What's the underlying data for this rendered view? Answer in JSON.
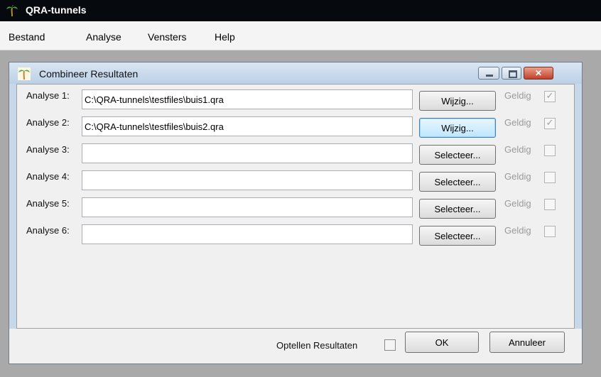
{
  "app": {
    "title": "QRA-tunnels",
    "icon": "palm-tree-icon",
    "menu": [
      "Bestand",
      "Analyse",
      "Vensters",
      "Help"
    ]
  },
  "dialog": {
    "title": "Combineer Resultaten",
    "icon": "palm-tree-icon",
    "rows": [
      {
        "label": "Analyse 1:",
        "path": "C:\\QRA-tunnels\\testfiles\\buis1.qra",
        "button": "Wijzig...",
        "valid_label": "Geldig",
        "valid_checked": true
      },
      {
        "label": "Analyse 2:",
        "path": "C:\\QRA-tunnels\\testfiles\\buis2.qra",
        "button": "Wijzig...",
        "valid_label": "Geldig",
        "valid_checked": true
      },
      {
        "label": "Analyse 3:",
        "path": "",
        "button": "Selecteer...",
        "valid_label": "Geldig",
        "valid_checked": false
      },
      {
        "label": "Analyse 4:",
        "path": "",
        "button": "Selecteer...",
        "valid_label": "Geldig",
        "valid_checked": false
      },
      {
        "label": "Analyse 5:",
        "path": "",
        "button": "Selecteer...",
        "valid_label": "Geldig",
        "valid_checked": false
      },
      {
        "label": "Analyse 6:",
        "path": "",
        "button": "Selecteer...",
        "valid_label": "Geldig",
        "valid_checked": false
      }
    ],
    "sum_label": "Optellen Resultaten",
    "sum_checked": false,
    "ok_label": "OK",
    "cancel_label": "Annuleer"
  },
  "colors": {
    "app_titlebar": "#06090e",
    "dialog_frame": "#c7d8ea",
    "close_button": "#c2412a",
    "disabled_text": "#9a9a9a"
  }
}
